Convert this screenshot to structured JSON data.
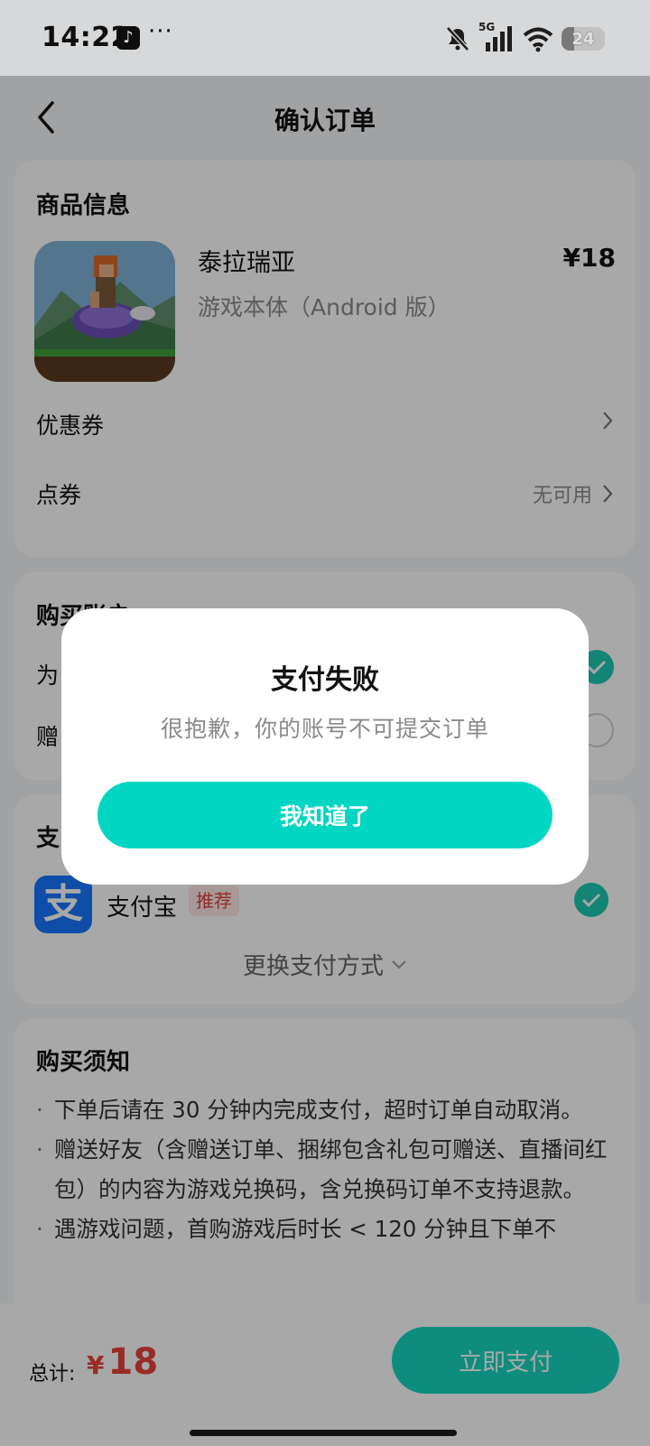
{
  "status_bar": {
    "time": "14:22",
    "app_icon_glyph": "♪",
    "more_dots": "···",
    "network": "5G",
    "battery": "24"
  },
  "nav": {
    "title": "确认订单"
  },
  "product": {
    "section_title": "商品信息",
    "name": "泰拉瑞亚",
    "price": "¥18",
    "edition": "游戏本体（Android 版）",
    "coupon_label": "优惠券",
    "points_label": "点券",
    "points_value": "无可用"
  },
  "account": {
    "section_title_partial": "购买账户",
    "row1_partial": "为",
    "row2_partial": "赠"
  },
  "payment": {
    "section_title_partial": "支",
    "method_icon_glyph": "支",
    "method_name": "支付宝",
    "recommend_badge": "推荐",
    "change_label": "更换支付方式"
  },
  "notice": {
    "title": "购买须知",
    "items": [
      "下单后请在 30 分钟内完成支付，超时订单自动取消。",
      "赠送好友（含赠送订单、捆绑包含礼包可赠送、直播间红包）的内容为游戏兑换码，含兑换码订单不支持退款。",
      "遇游戏问题，首购游戏后时长 < 120 分钟且下单不"
    ]
  },
  "bottom_bar": {
    "total_label": "总计:",
    "currency": "¥",
    "total_amount": "18",
    "pay_button": "立即支付"
  },
  "dialog": {
    "title": "支付失败",
    "message": "很抱歉，你的账号不可提交订单",
    "confirm_button": "我知道了"
  },
  "colors": {
    "accent": "#16d6c0",
    "price_red": "#e8423a",
    "alipay_blue": "#1677ff"
  }
}
